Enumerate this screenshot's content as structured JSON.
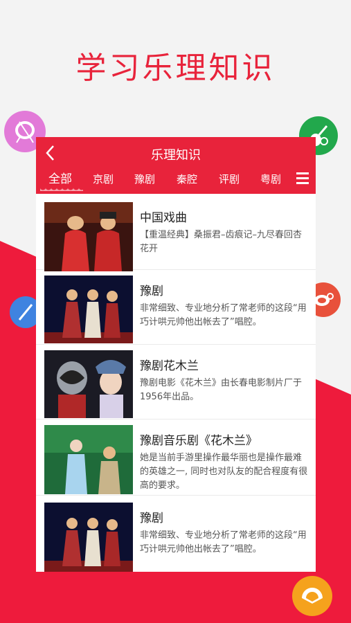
{
  "headline": "学习乐理知识",
  "header": {
    "title": "乐理知识",
    "back_label": "<"
  },
  "tabs": [
    {
      "label": "全部",
      "active": true
    },
    {
      "label": "京剧",
      "active": false
    },
    {
      "label": "豫剧",
      "active": false
    },
    {
      "label": "秦腔",
      "active": false
    },
    {
      "label": "评剧",
      "active": false
    },
    {
      "label": "粤剧",
      "active": false
    }
  ],
  "list": [
    {
      "title": "中国戏曲",
      "desc": "【重温经典】桑振君–齿痕记–九尽春回杏花开"
    },
    {
      "title": "豫剧",
      "desc": "非常细致、专业地分析了常老师的这段“用巧计哄元帅他出帐去了”唱腔。"
    },
    {
      "title": "豫剧花木兰",
      "desc": "豫剧电影《花木兰》由长春电影制片厂于1956年出品。"
    },
    {
      "title": "豫剧音乐剧《花木兰》",
      "desc": "她是当前手游里操作最华丽也是操作最难的英雄之一, 同时也对队友的配合程度有很高的要求。"
    },
    {
      "title": "豫剧",
      "desc": "非常细致、专业地分析了常老师的这段“用巧计哄元帅他出帐去了”唱腔。"
    }
  ],
  "colors": {
    "brand_red": "#e8233b",
    "fab_drum": "#e27ad8",
    "fab_guitar": "#22a84c",
    "fab_flute": "#3f83e0",
    "fab_gong": "#e8513b",
    "fab_fan": "#f5a21d"
  },
  "icons": {
    "drum": "drum-icon",
    "guitar": "pipa-icon",
    "flute": "flute-icon",
    "gong": "gong-icon",
    "fan": "fan-icon"
  }
}
